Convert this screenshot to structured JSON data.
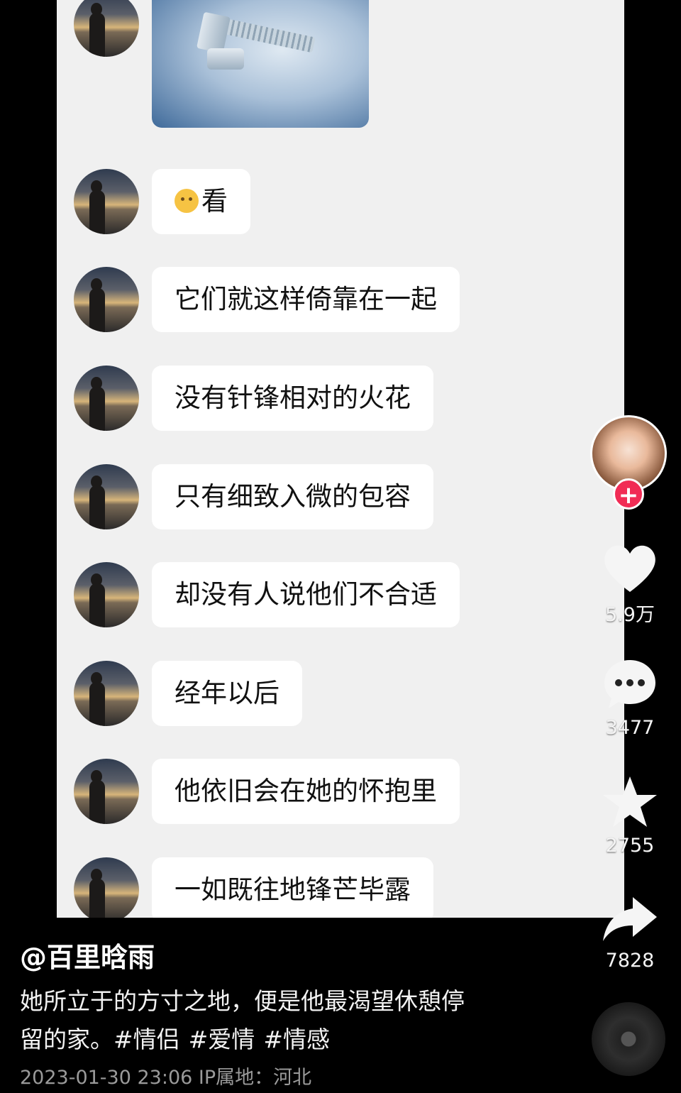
{
  "chat": {
    "messages": [
      {
        "type": "image",
        "alt": "bolt-and-nut-photo"
      },
      {
        "type": "text",
        "emoji": "worried-face-emoji",
        "text": "看"
      },
      {
        "type": "text",
        "text": "它们就这样倚靠在一起"
      },
      {
        "type": "text",
        "text": "没有针锋相对的火花"
      },
      {
        "type": "text",
        "text": "只有细致入微的包容"
      },
      {
        "type": "text",
        "text": "却没有人说他们不合适"
      },
      {
        "type": "text",
        "text": "经年以后"
      },
      {
        "type": "text",
        "text": "他依旧会在她的怀抱里"
      },
      {
        "type": "text",
        "text": "一如既往地锋芒毕露"
      }
    ]
  },
  "rail": {
    "follow_label": "+",
    "likes": "5.9万",
    "comments": "3477",
    "favorites": "2755",
    "shares": "7828"
  },
  "post": {
    "author": "@百里晗雨",
    "caption_line1": "她所立于的方寸之地，便是他最渴望休憩停",
    "caption_line2": "留的家。",
    "tags": [
      "#情侣",
      "#爱情",
      "#情感"
    ],
    "meta": "2023-01-30 23:06 IP属地：河北"
  },
  "colors": {
    "background": "#000000",
    "chat_panel": "#f0f0f0",
    "bubble": "#ffffff",
    "follow_accent": "#f12c55"
  }
}
